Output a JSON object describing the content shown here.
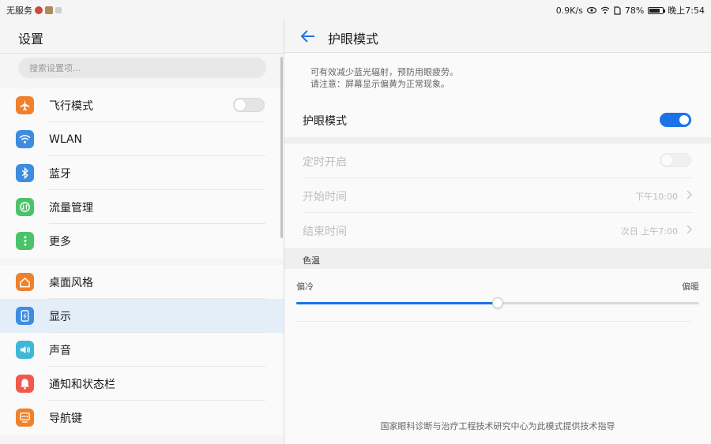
{
  "status_bar": {
    "carrier": "无服务",
    "speed": "0.9K/s",
    "battery_text": "78%",
    "battery_level": 0.78,
    "time": "晚上7:54"
  },
  "sidebar": {
    "title": "设置",
    "search_placeholder": "搜索设置项...",
    "group1": [
      {
        "label": "飞行模式",
        "icon": "airplane-icon",
        "color": "#f0812c",
        "toggle": "off"
      },
      {
        "label": "WLAN",
        "icon": "wifi-icon",
        "color": "#3e8ce0"
      },
      {
        "label": "蓝牙",
        "icon": "bluetooth-icon",
        "color": "#3e8ce0"
      },
      {
        "label": "流量管理",
        "icon": "data-usage-icon",
        "color": "#4cc36a"
      },
      {
        "label": "更多",
        "icon": "more-icon",
        "color": "#4cc36a"
      }
    ],
    "group2": [
      {
        "label": "桌面风格",
        "icon": "home-style-icon",
        "color": "#f0812c"
      },
      {
        "label": "显示",
        "icon": "display-icon",
        "color": "#3e8ce0",
        "active": true
      },
      {
        "label": "声音",
        "icon": "sound-icon",
        "color": "#3fb7d8"
      },
      {
        "label": "通知和状态栏",
        "icon": "notification-icon",
        "color": "#ef5a4c"
      },
      {
        "label": "导航键",
        "icon": "navigation-key-icon",
        "color": "#f0812c"
      }
    ]
  },
  "detail": {
    "title": "护眼模式",
    "description_line1": "可有效减少蓝光辐射，预防用眼疲劳。",
    "description_line2": "请注意：屏幕显示偏黄为正常现象。",
    "eye_mode_label": "护眼模式",
    "eye_mode_on": true,
    "schedule_label": "定时开启",
    "schedule_on": false,
    "start_label": "开始时间",
    "start_value": "下午10:00",
    "end_label": "结束时间",
    "end_value": "次日 上午7:00",
    "color_temp_title": "色温",
    "cooler_label": "偏冷",
    "warmer_label": "偏暖",
    "color_temp_level": 0.5,
    "footer_note": "国家眼科诊断与治疗工程技术研究中心为此模式提供技术指导"
  },
  "colors": {
    "accent": "#1a73e8",
    "active_row": "#e3eef9"
  }
}
